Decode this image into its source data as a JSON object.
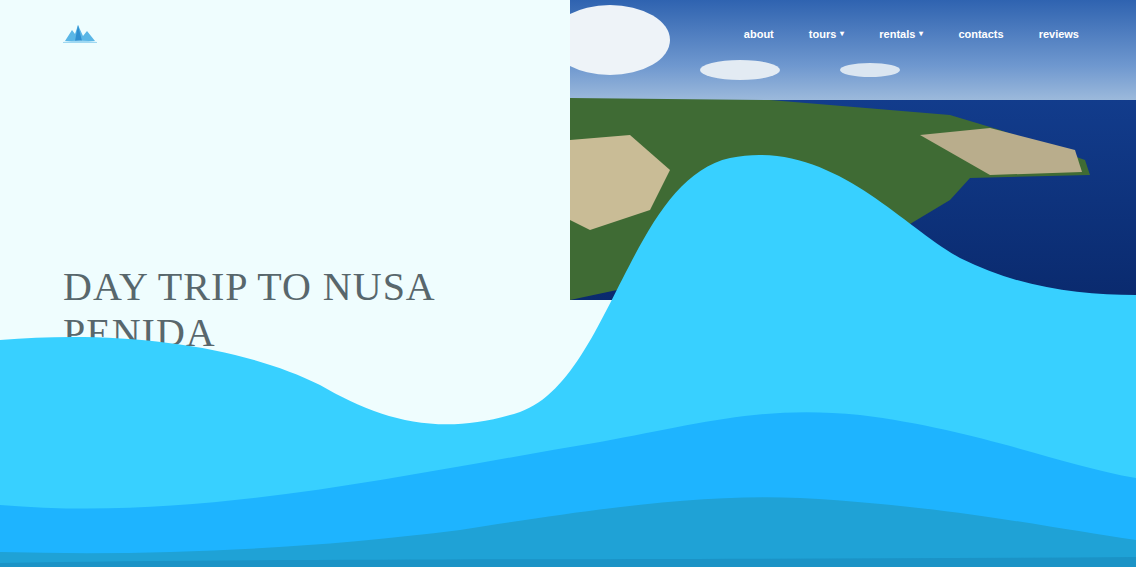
{
  "nav": [
    {
      "label": "about"
    },
    {
      "label": "tours",
      "caret": "▾"
    },
    {
      "label": "rentals",
      "caret": "▾"
    },
    {
      "label": "contacts"
    },
    {
      "label": "reviews"
    }
  ],
  "hero": {
    "title": "DAY TRIP TO NUSA PENIDA"
  }
}
